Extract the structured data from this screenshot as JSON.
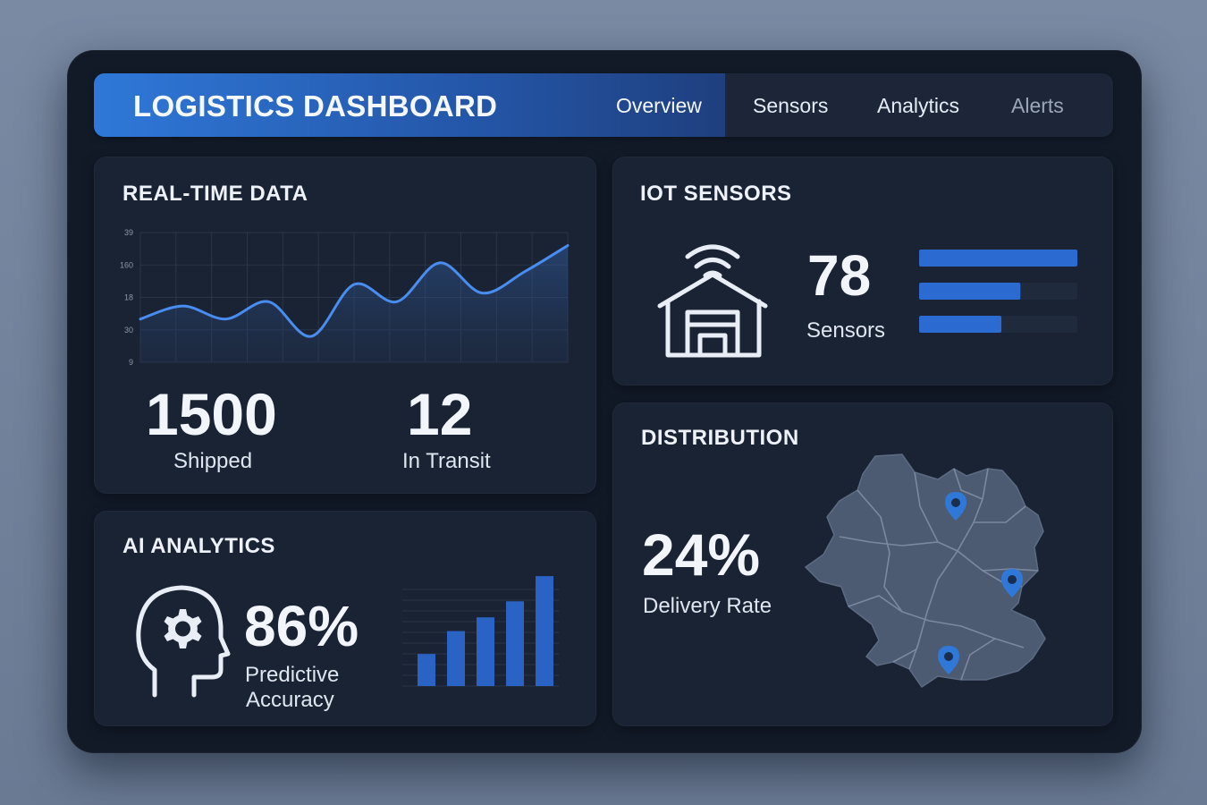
{
  "header": {
    "title": "LOGISTICS DASHBOARD",
    "tabs": [
      {
        "label": "Overview"
      },
      {
        "label": "Sensors"
      },
      {
        "label": "Analytics"
      },
      {
        "label": "Alerts"
      }
    ],
    "accent_color": "#2f78d8"
  },
  "realtime": {
    "title": "REAL-TIME DATA",
    "shipped_value": "1500",
    "shipped_label": "Shipped",
    "transit_value": "12",
    "transit_label": "In Transit"
  },
  "iot": {
    "title": "IOT SENSORS",
    "icon": "warehouse-wifi-icon",
    "value": "78",
    "label": "Sensors",
    "bars": [
      1.0,
      0.64,
      0.52
    ]
  },
  "ai": {
    "title": "AI ANALYTICS",
    "icon": "head-gear-icon",
    "value": "86%",
    "label_line1": "Predictive",
    "label_line2": "Accuracy"
  },
  "distribution": {
    "title": "DISTRIBUTION",
    "value": "24%",
    "label": "Delivery Rate",
    "icon": "map-pin-icon"
  },
  "chart_data": [
    {
      "type": "area",
      "y_tick_labels": [
        "39",
        "160",
        "18",
        "30",
        "9"
      ],
      "values": [
        30,
        33,
        30,
        34,
        26,
        38,
        34,
        43,
        36,
        41,
        47
      ],
      "color": "#4a8df0"
    },
    {
      "type": "bar",
      "values": [
        28,
        48,
        60,
        74,
        96
      ],
      "ylim": [
        0,
        100
      ],
      "color": "#2b63c4"
    }
  ]
}
